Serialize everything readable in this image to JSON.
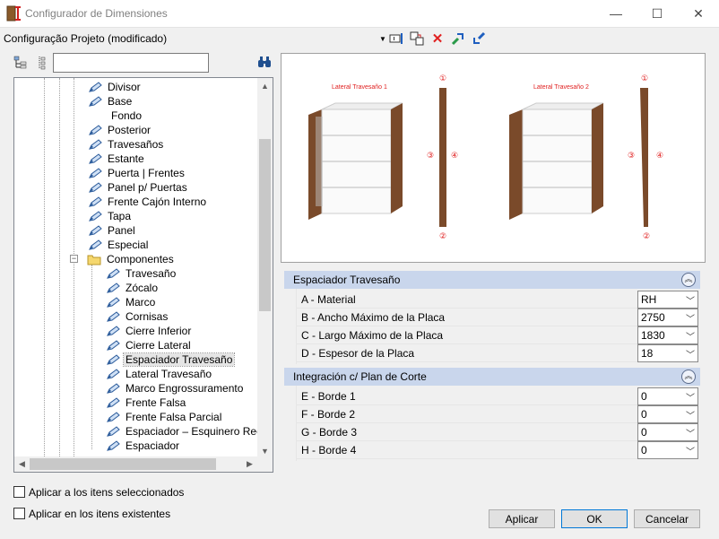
{
  "window": {
    "title": "Configurador de Dimensiones",
    "minimize": "—",
    "maximize": "☐",
    "close": "✕"
  },
  "header": {
    "config_label": "Configuração Projeto (modificado)"
  },
  "tree": {
    "items": [
      {
        "label": "Divisor",
        "level": 3
      },
      {
        "label": "Base",
        "level": 3
      },
      {
        "label": "Fondo",
        "level": 4
      },
      {
        "label": "Posterior",
        "level": 3
      },
      {
        "label": "Travesaños",
        "level": 3
      },
      {
        "label": "Estante",
        "level": 3
      },
      {
        "label": "Puerta | Frentes",
        "level": 3
      },
      {
        "label": "Panel p/ Puertas",
        "level": 3
      },
      {
        "label": "Frente Cajón Interno",
        "level": 3
      },
      {
        "label": "Tapa",
        "level": 3
      },
      {
        "label": "Panel",
        "level": 3
      },
      {
        "label": "Especial",
        "level": 3
      },
      {
        "label": "Componentes",
        "level": 2
      },
      {
        "label": "Travesaño",
        "level": 4
      },
      {
        "label": "Zócalo",
        "level": 4
      },
      {
        "label": "Marco",
        "level": 4
      },
      {
        "label": "Cornisas",
        "level": 4
      },
      {
        "label": "Cierre Inferior",
        "level": 4
      },
      {
        "label": "Cierre Lateral",
        "level": 4
      },
      {
        "label": "Espaciador Travesaño",
        "level": 4,
        "selected": true
      },
      {
        "label": "Lateral Travesaño",
        "level": 4
      },
      {
        "label": "Marco Engrossuramento",
        "level": 4
      },
      {
        "label": "Frente Falsa",
        "level": 4
      },
      {
        "label": "Frente Falsa Parcial",
        "level": 4
      },
      {
        "label": "Espaciador – Esquinero Recto",
        "level": 4
      },
      {
        "label": "Espaciador",
        "level": 4
      }
    ]
  },
  "preview": {
    "label_left": "Lateral Travesaño 1",
    "label_right": "Lateral Travesaño 2",
    "markers": [
      "①",
      "②",
      "③",
      "④"
    ]
  },
  "properties": {
    "categories": [
      {
        "title": "Espaciador Travesaño",
        "rows": [
          {
            "name": "A - Material",
            "value": "RH"
          },
          {
            "name": "B -  Ancho Máximo de la Placa",
            "value": "2750"
          },
          {
            "name": "C - Largo Máximo de la Placa",
            "value": "1830"
          },
          {
            "name": "D - Espesor de la Placa",
            "value": "18"
          }
        ]
      },
      {
        "title": "Integración c/ Plan de Corte",
        "rows": [
          {
            "name": "E - Borde 1",
            "value": "0"
          },
          {
            "name": "F - Borde 2",
            "value": "0"
          },
          {
            "name": "G - Borde 3",
            "value": "0"
          },
          {
            "name": "H - Borde 4",
            "value": "0"
          }
        ]
      }
    ]
  },
  "footer": {
    "check_selected": "Aplicar a los itens seleccionados",
    "check_existing": "Aplicar en los itens existentes",
    "apply": "Aplicar",
    "ok": "OK",
    "cancel": "Cancelar"
  },
  "colors": {
    "accent": "#0078d7",
    "category_bg": "#c9d6ec",
    "wood": "#7a4a2a",
    "label_red": "#e02020"
  }
}
